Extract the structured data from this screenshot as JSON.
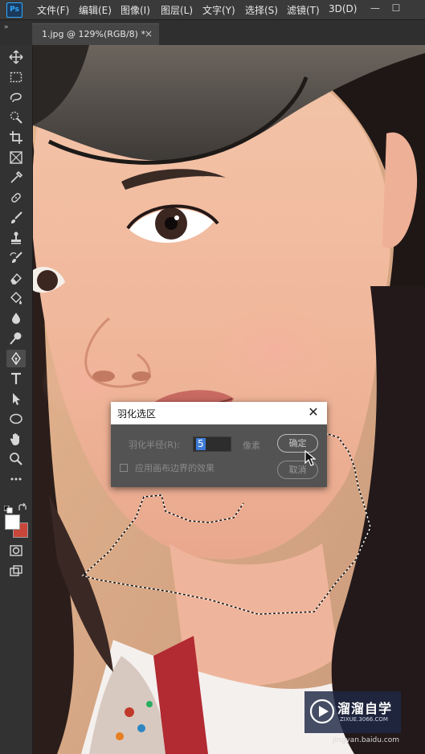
{
  "app": {
    "logo": "Ps"
  },
  "menu": [
    "文件(F)",
    "编辑(E)",
    "图像(I)",
    "图层(L)",
    "文字(Y)",
    "选择(S)",
    "滤镜(T)",
    "3D(D)"
  ],
  "window_controls": {
    "minimize": "—",
    "maximize": "☐"
  },
  "tab": {
    "title": "1.jpg @ 129%(RGB/8) *",
    "close": "×"
  },
  "panel_toggle": "»",
  "toolbar": {
    "tools": [
      "move-tool",
      "marquee-tool",
      "lasso-tool",
      "quick-select-tool",
      "crop-tool",
      "frame-tool",
      "eyedropper-tool",
      "healing-brush-tool",
      "brush-tool",
      "clone-stamp-tool",
      "history-brush-tool",
      "eraser-tool",
      "paint-bucket-tool",
      "blur-tool",
      "dodge-tool",
      "pen-tool",
      "type-tool",
      "path-selection-tool",
      "ellipse-tool",
      "hand-tool",
      "zoom-tool",
      "more-tools",
      "swap-colors",
      "foreground-color",
      "quick-mask",
      "screen-mode"
    ],
    "active_tool": "pen-tool",
    "foreground_color": "#ffffff",
    "background_color": "#c9473a"
  },
  "dialog": {
    "title": "羽化选区",
    "close": "✕",
    "radius_label": "羽化半径(R):",
    "radius_value": "5",
    "radius_unit": "像素",
    "checkbox_label": "应用画布边界的效果",
    "checkbox_checked": false,
    "ok_label": "确定",
    "cancel_label": "取消"
  },
  "watermark": {
    "title": "溜溜自学",
    "subtitle": "ZIXUE.3066.COM",
    "source": "jingyan.baidu.com"
  }
}
